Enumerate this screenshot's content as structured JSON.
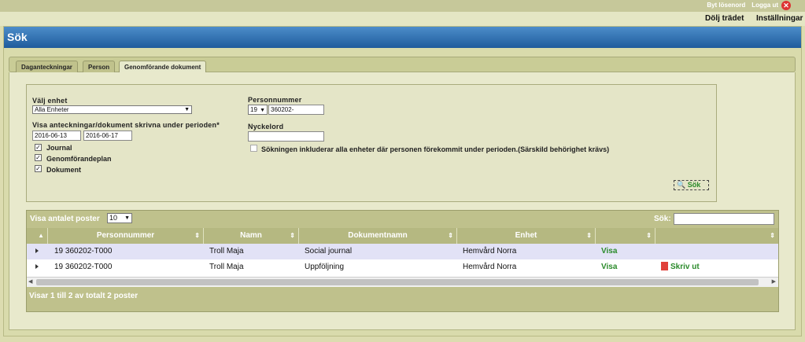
{
  "topbar": {
    "change_password": "Byt lösenord",
    "logout": "Logga ut"
  },
  "subbar": {
    "hide_tree": "Dölj trädet",
    "settings": "Inställningar"
  },
  "panel": {
    "title": "Sök"
  },
  "tabs": [
    {
      "label": "Daganteckningar"
    },
    {
      "label": "Person"
    },
    {
      "label": "Genomförande dokument"
    }
  ],
  "form": {
    "unit_label": "Välj enhet",
    "unit_value": "Alla Enheter",
    "period_label": "Visa anteckningar/dokument skrivna under perioden*",
    "date_from": "2016-06-13",
    "date_to": "2016-06-17",
    "checkboxes": [
      {
        "label": "Journal",
        "checked": true
      },
      {
        "label": "Genomförandeplan",
        "checked": true
      },
      {
        "label": "Dokument",
        "checked": true
      }
    ],
    "personnummer_label": "Personnummer",
    "century_value": "19",
    "personnummer_value": "360202-",
    "keyword_label": "Nyckelord",
    "keyword_value": "",
    "include_all_label": "Sökningen inkluderar alla enheter där personen förekommit under perioden.(Särskild behörighet krävs)",
    "include_all_checked": false,
    "search_button": "Sök"
  },
  "grid": {
    "show_label": "Visa antalet poster",
    "page_size": "10",
    "search_label": "Sök:",
    "search_value": "",
    "columns": [
      "Personnummer",
      "Namn",
      "Dokumentnamn",
      "Enhet"
    ],
    "rows": [
      {
        "personnummer": "19 360202-T000",
        "namn": "Troll Maja",
        "dokument": "Social journal",
        "enhet": "Hemvård Norra",
        "visa": "Visa",
        "print": ""
      },
      {
        "personnummer": "19 360202-T000",
        "namn": "Troll Maja",
        "dokument": "Uppföljning",
        "enhet": "Hemvård Norra",
        "visa": "Visa",
        "print": "Skriv ut"
      }
    ],
    "footer": "Visar 1 till 2 av totalt 2 poster"
  },
  "colors": {
    "header_blue": "#1f5c9c",
    "accent_green": "#2a8a2a",
    "panel_bg": "#d9dbac"
  },
  "icons": [
    "close-icon",
    "search-icon",
    "pdf-icon",
    "sort-icon",
    "expand-icon",
    "dropdown-icon"
  ]
}
